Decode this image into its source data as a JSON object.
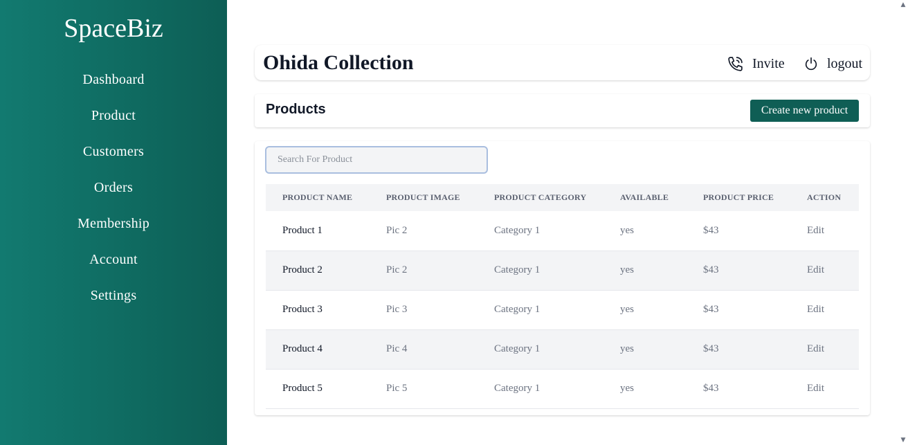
{
  "sidebar": {
    "brand": "SpaceBiz",
    "items": [
      {
        "label": "Dashboard"
      },
      {
        "label": "Product"
      },
      {
        "label": "Customers"
      },
      {
        "label": "Orders"
      },
      {
        "label": "Membership"
      },
      {
        "label": "Account"
      },
      {
        "label": "Settings"
      }
    ]
  },
  "header": {
    "store_name": "Ohida Collection",
    "invite_label": "Invite",
    "logout_label": "logout"
  },
  "products_bar": {
    "title": "Products",
    "create_label": "Create new product"
  },
  "search": {
    "placeholder": "Search For Product",
    "value": ""
  },
  "table": {
    "columns": [
      "PRODUCT NAME",
      "PRODUCT IMAGE",
      "PRODUCT CATEGORY",
      "AVAILABLE",
      "PRODUCT PRICE",
      "ACTION"
    ],
    "rows": [
      {
        "name": "Product 1",
        "image": "Pic 2",
        "category": "Category 1",
        "available": "yes",
        "price": "$43",
        "action": "Edit"
      },
      {
        "name": "Product 2",
        "image": "Pic 2",
        "category": "Category 1",
        "available": "yes",
        "price": "$43",
        "action": "Edit"
      },
      {
        "name": "Product 3",
        "image": "Pic 3",
        "category": "Category 1",
        "available": "yes",
        "price": "$43",
        "action": "Edit"
      },
      {
        "name": "Product 4",
        "image": "Pic 4",
        "category": "Category 1",
        "available": "yes",
        "price": "$43",
        "action": "Edit"
      },
      {
        "name": "Product 5",
        "image": "Pic 5",
        "category": "Category 1",
        "available": "yes",
        "price": "$43",
        "action": "Edit"
      }
    ]
  },
  "colors": {
    "sidebar_start": "#127a70",
    "sidebar_end": "#0d5e55",
    "button_bg": "#0f5e55",
    "search_border": "#a9bedf",
    "row_alt": "#f3f4f6"
  },
  "icons": {
    "invite": "phone-icon",
    "logout": "power-icon",
    "scroll_up": "scroll-up-arrow-icon",
    "scroll_down": "scroll-down-arrow-icon"
  }
}
